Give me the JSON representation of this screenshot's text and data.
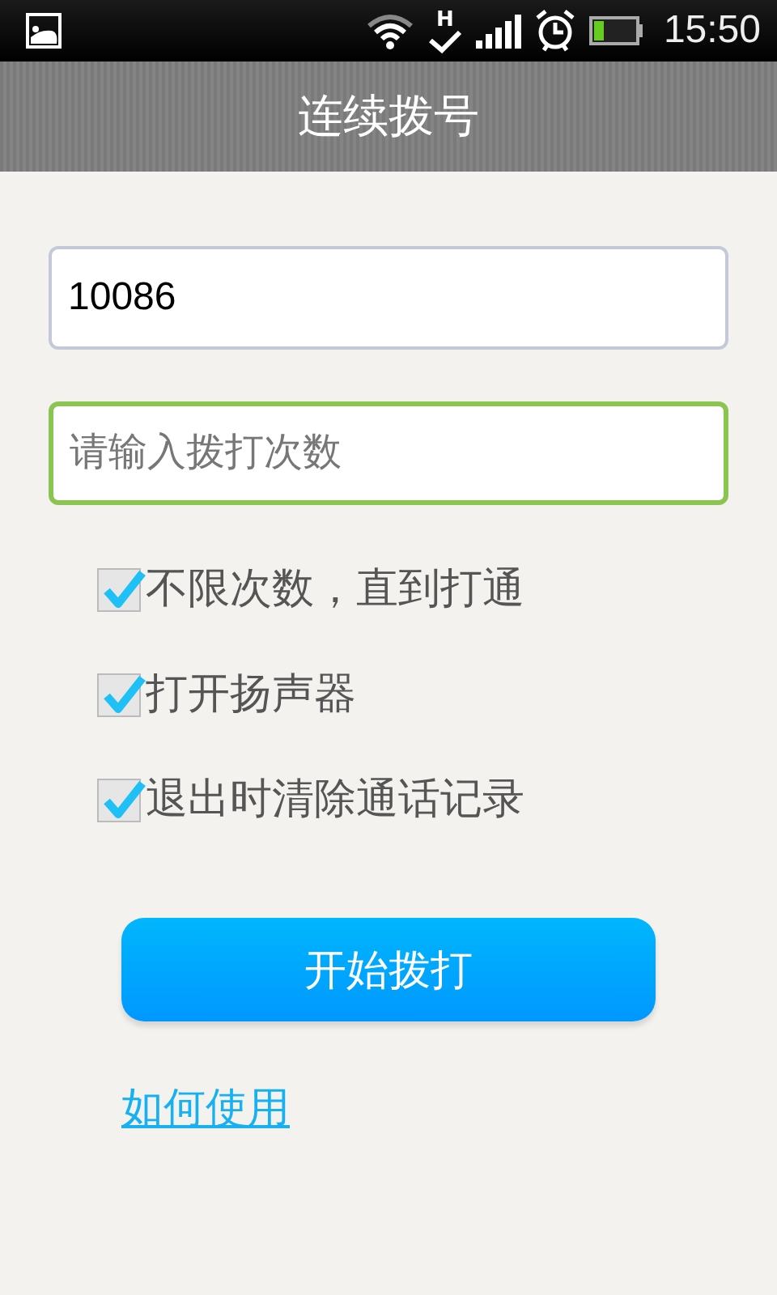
{
  "status_bar": {
    "time": "15:50",
    "network_type": "H"
  },
  "title_bar": {
    "title": "连续拨号"
  },
  "fields": [
    {
      "value": "10086",
      "focused": false
    },
    {
      "placeholder": "请输入拨打次数",
      "focused": true
    }
  ],
  "options": [
    {
      "label": "不限次数，直到打通",
      "checked": true
    },
    {
      "label": "打开扬声器",
      "checked": true
    },
    {
      "label": "退出时清除通话记录",
      "checked": true
    }
  ],
  "start_button": {
    "label": "开始拨打"
  },
  "help_link": {
    "label": "如何使用"
  }
}
